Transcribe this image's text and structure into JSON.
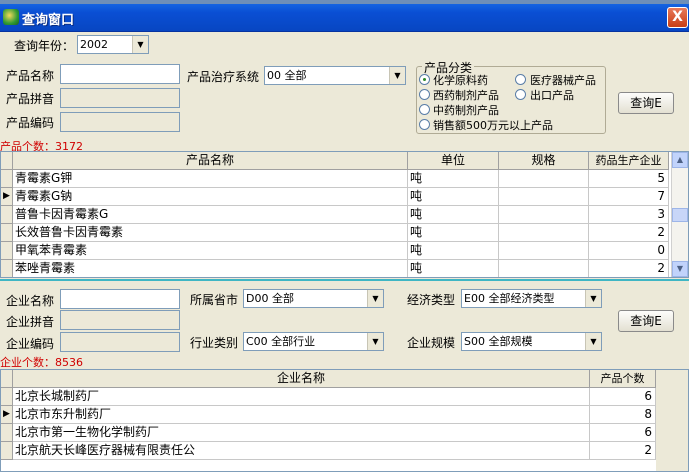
{
  "window": {
    "title": "查询窗口",
    "close_label": "X"
  },
  "year": {
    "label": "查询年份：",
    "value": "2002"
  },
  "product_search": {
    "name_label": "产品名称",
    "pinyin_label": "产品拼音",
    "code_label": "产品编码",
    "system_label": "产品治疗系统",
    "system_value": "00   全部",
    "category": {
      "title": "产品分类",
      "options": [
        "化学原料药",
        "医疗器械产品",
        "西药制剂产品",
        "出口产品",
        "中药制剂产品",
        "销售额500万元以上产品"
      ],
      "selected": "化学原料药"
    },
    "query_button": "查询E"
  },
  "product_count": "产品个数：3172",
  "product_table": {
    "columns": [
      "产品名称",
      "单位",
      "规格",
      "药品生产企业"
    ],
    "rows": [
      {
        "name": "青霉素G钾",
        "unit": "吨",
        "spec": "",
        "count": "5"
      },
      {
        "name": "青霉素G钠",
        "unit": "吨",
        "spec": "",
        "count": "7"
      },
      {
        "name": "普鲁卡因青霉素G",
        "unit": "吨",
        "spec": "",
        "count": "3"
      },
      {
        "name": "长效普鲁卡因青霉素",
        "unit": "吨",
        "spec": "",
        "count": "2"
      },
      {
        "name": "甲氧苯青霉素",
        "unit": "吨",
        "spec": "",
        "count": "0"
      },
      {
        "name": "苯唑青霉素",
        "unit": "吨",
        "spec": "",
        "count": "2"
      }
    ],
    "current_row_marker": "▶"
  },
  "company_search": {
    "name_label": "企业名称",
    "pinyin_label": "企业拼音",
    "code_label": "企业编码",
    "province_label": "所属省市",
    "province_value": "D00      全部",
    "industry_label": "行业类别",
    "industry_value": "C00      全部行业",
    "econ_label": "经济类型",
    "econ_value": "E00      全部经济类型",
    "scale_label": "企业规模",
    "scale_value": "S00      全部规模",
    "query_button": "查询E"
  },
  "company_count": "企业个数：8536",
  "company_table": {
    "columns": [
      "企业名称",
      "产品个数"
    ],
    "rows": [
      {
        "name": "北京长城制药厂",
        "count": "6"
      },
      {
        "name": "北京市东升制药厂",
        "count": "8"
      },
      {
        "name": "北京市第一生物化学制药厂",
        "count": "6"
      },
      {
        "name": "北京航天长峰医疗器械有限责任公",
        "count": "2"
      }
    ]
  },
  "icons": [
    "app-icon",
    "close-icon",
    "dropdown-arrow-icon",
    "scroll-up-icon",
    "scroll-down-icon",
    "row-pointer-icon"
  ]
}
